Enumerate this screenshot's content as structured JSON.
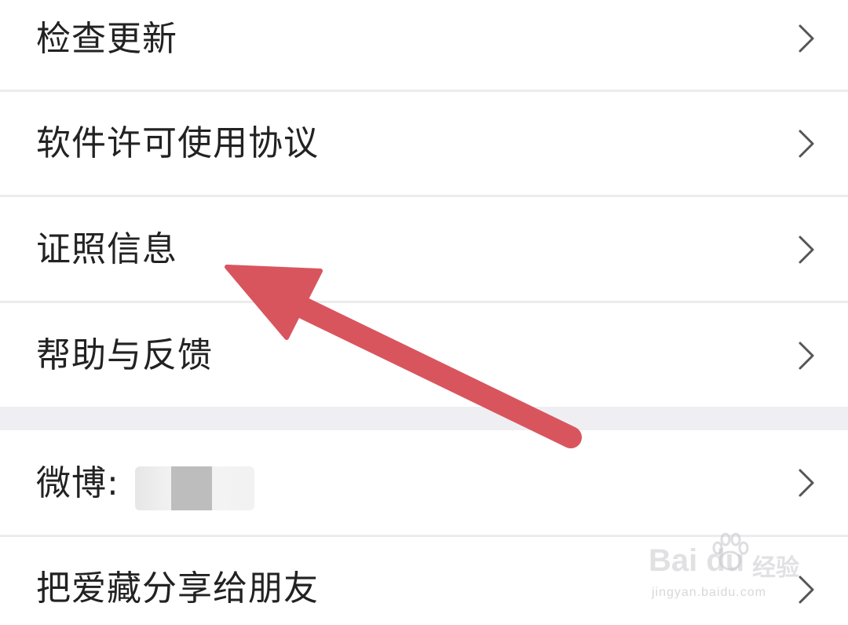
{
  "menu": {
    "items": [
      {
        "label": "检查更新"
      },
      {
        "label": "软件许可使用协议"
      },
      {
        "label": "证照信息"
      },
      {
        "label": "帮助与反馈"
      }
    ]
  },
  "social": {
    "items": [
      {
        "label": "微博:"
      },
      {
        "label": "把爱藏分享给朋友"
      }
    ]
  },
  "icons": {
    "chevron": "chevron-right-icon"
  },
  "annotation": {
    "arrow_color": "#d9555e"
  },
  "watermark": {
    "brand": "Bai du",
    "product": "经验",
    "url": "jingyan.baidu.com"
  }
}
